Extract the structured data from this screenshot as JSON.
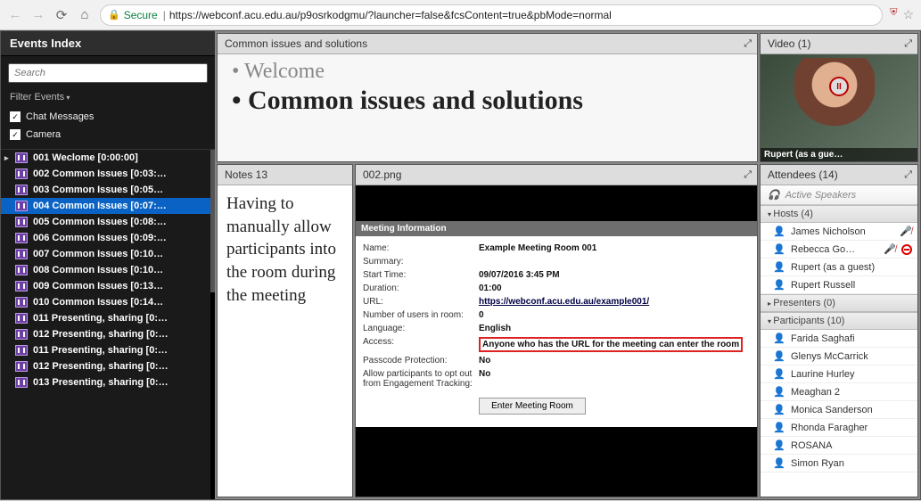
{
  "browser": {
    "secure_label": "Secure",
    "url": "https://webconf.acu.edu.au/p9osrkodgmu/?launcher=false&fcsContent=true&pbMode=normal"
  },
  "sidebar": {
    "title": "Events Index",
    "search_placeholder": "Search",
    "filter_label": "Filter Events",
    "chk_chat": "Chat Messages",
    "chk_camera": "Camera",
    "events": [
      "001 Weclome [0:00:00]",
      "002 Common Issues [0:03:…",
      "003 Common Issues [0:05…",
      "004 Common Issues [0:07:…",
      "005 Common Issues [0:08:…",
      "006 Common Issues [0:09:…",
      "007 Common Issues [0:10…",
      "008 Common Issues [0:10…",
      "009 Common Issues [0:13…",
      "010 Common Issues [0:14…",
      "011 Presenting, sharing [0:…",
      "012 Presenting, sharing [0:…",
      "011 Presenting, sharing [0:…",
      "012 Presenting, sharing [0:…",
      "013 Presenting, sharing [0:…"
    ],
    "selected_index": 3
  },
  "solutions": {
    "title": "Common issues and solutions",
    "line1": "Welcome",
    "line2": "Common issues and solutions"
  },
  "video": {
    "title": "Video  (1)",
    "caption": "Rupert (as a gue…"
  },
  "notes": {
    "title": "Notes 13",
    "text": "Having to manually allow participants into the room during the meeting"
  },
  "shot": {
    "title": "002.png",
    "header": "Meeting Information",
    "rows": {
      "name_k": "Name:",
      "name_v": "Example Meeting Room 001",
      "sum_k": "Summary:",
      "sum_v": "",
      "start_k": "Start Time:",
      "start_v": "09/07/2016 3:45 PM",
      "dur_k": "Duration:",
      "dur_v": "01:00",
      "url_k": "URL:",
      "url_v": "https://webconf.acu.edu.au/example001/",
      "num_k": "Number of users in room:",
      "num_v": "0",
      "lang_k": "Language:",
      "lang_v": "English",
      "acc_k": "Access:",
      "acc_v": "Anyone who has the URL for the meeting can enter the room",
      "pass_k": "Passcode Protection:",
      "pass_v": "No",
      "opt_k": "Allow participants to opt out from Engagement Tracking:",
      "opt_v": "No"
    },
    "enter_btn": "Enter Meeting Room"
  },
  "attendees": {
    "title": "Attendees  (14)",
    "active": "Active Speakers",
    "groups": {
      "hosts_label": "Hosts (4)",
      "presenters_label": "Presenters (0)",
      "participants_label": "Participants (10)"
    },
    "hosts": [
      "James Nicholson",
      "Rebecca Go…",
      "Rupert (as a guest)",
      "Rupert Russell"
    ],
    "participants": [
      "Farida Saghafi",
      "Glenys McCarrick",
      "Laurine Hurley",
      "Meaghan 2",
      "Monica Sanderson",
      "Rhonda Faragher",
      "ROSANA",
      "Simon Ryan"
    ]
  }
}
